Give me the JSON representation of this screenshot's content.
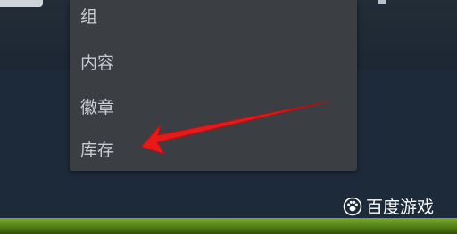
{
  "menu": {
    "items": [
      {
        "label": "组"
      },
      {
        "label": "内容"
      },
      {
        "label": "徽章"
      },
      {
        "label": "库存"
      }
    ]
  },
  "watermark": {
    "text": "百度游戏"
  },
  "colors": {
    "menu_background": "#3b3f44",
    "menu_text": "#c8ccd1",
    "page_background": "#1d2b3b",
    "arrow": "#e8191a",
    "bottom_strip": "#5c8a1d"
  },
  "icons": {
    "watermark_logo": "baidu-paw-logo",
    "annotation": "red-arrow"
  }
}
